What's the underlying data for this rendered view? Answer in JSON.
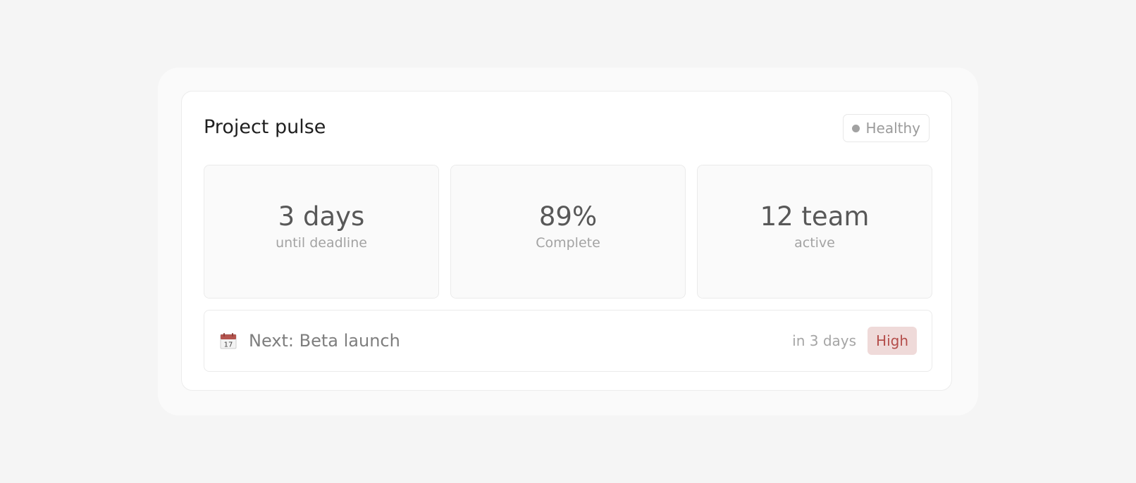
{
  "card": {
    "title": "Project pulse",
    "status": {
      "label": "Healthy",
      "dot_color": "#a2a2a2"
    }
  },
  "stats": [
    {
      "value": "3 days",
      "label": "until deadline"
    },
    {
      "value": "89%",
      "label": "Complete"
    },
    {
      "value": "12 team",
      "label": "active"
    }
  ],
  "next_milestone": {
    "icon": "calendar-icon",
    "calendar_day": "17",
    "label": "Next: Beta launch",
    "due": "in 3 days",
    "priority": "High",
    "priority_color": "#b44d4a"
  }
}
